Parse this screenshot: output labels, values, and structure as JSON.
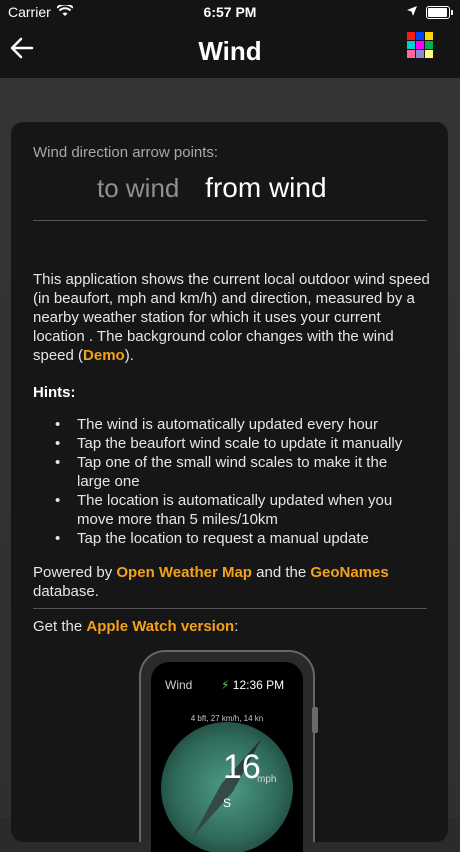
{
  "status": {
    "carrier": "Carrier",
    "time": "6:57 PM"
  },
  "nav": {
    "title": "Wind",
    "color_grid": [
      "#ff1a1a",
      "#0044ff",
      "#ffd700",
      "#ffffff",
      "#00cfd0",
      "#ff00ff",
      "#00b050",
      "#ffffff",
      "#ff6a9a",
      "#8a8ad0",
      "#ffff80",
      "#ffffff"
    ]
  },
  "card": {
    "caption": "Wind direction arrow points:",
    "toggle_to": "to wind",
    "toggle_from": "from wind",
    "description_before": "This application shows the current local outdoor wind speed (in beaufort, mph and km/h) and direction, measured by a nearby weather station for which it uses your current location . The background color changes with the wind speed (",
    "demo_link": "Demo",
    "description_after": ").",
    "hints_title": "Hints:",
    "hints": [
      "The wind is automatically updated every hour",
      "Tap the beaufort wind scale to update it manually",
      "Tap one of the small wind scales to make it the large one",
      "The location is automatically updated when you move more than 5 miles/10km",
      "Tap the location to request a manual update"
    ],
    "powered_prefix": "Powered by ",
    "owm_link": "Open Weather Map",
    "powered_middle": " and the ",
    "geonames_link": "GeoNames",
    "powered_suffix": " database.",
    "get_prefix": "Get the ",
    "apple_watch_link": "Apple Watch version",
    "get_suffix": ":"
  },
  "watch": {
    "title": "Wind",
    "time": "12:36 PM",
    "stats": "4 bft, 27 km/h, 14 kn",
    "speed": "16",
    "unit": "mph",
    "direction": "S"
  }
}
